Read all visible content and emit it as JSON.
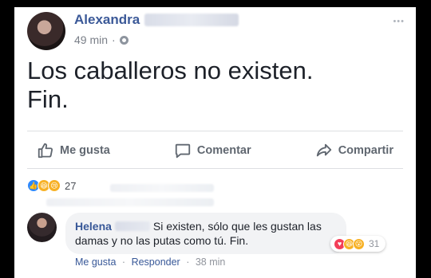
{
  "post": {
    "author_first": "Alexandra",
    "timestamp": "49 min",
    "text_line1": "Los caballeros no existen.",
    "text_line2": "Fin.",
    "more_icon": "more-dots-icon",
    "privacy_icon": "globe-icon"
  },
  "actions": {
    "like": "Me gusta",
    "comment": "Comentar",
    "share": "Compartir"
  },
  "reactions": {
    "types": [
      "like",
      "haha",
      "sad"
    ],
    "count": "27"
  },
  "comment": {
    "author_first": "Helena",
    "text": "Si existen, sólo que les gustan las damas y no las putas como tú. Fin.",
    "reaction_types": [
      "love",
      "haha",
      "wow"
    ],
    "reaction_count": "31",
    "like_label": "Me gusta",
    "reply_label": "Responder",
    "timestamp": "38 min",
    "separator": "·"
  },
  "colors": {
    "brand": "#3b5998",
    "link": "#385898",
    "muted": "#90949c",
    "like_blue": "#2d88ff",
    "love_red": "#f33e58",
    "emoji_yellow": "#f7b125"
  }
}
